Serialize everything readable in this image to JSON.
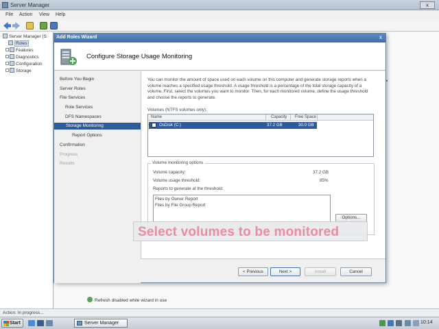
{
  "server_manager": {
    "title": "Server Manager",
    "close_glyph": "x",
    "menu": [
      "File",
      "Action",
      "View",
      "Help"
    ],
    "tree": [
      {
        "label": "Server Manager (S",
        "level": 0
      },
      {
        "label": "Roles",
        "level": 1,
        "selected": true
      },
      {
        "label": "Features",
        "level": 1
      },
      {
        "label": "Diagnostics",
        "level": 1
      },
      {
        "label": "Configuration",
        "level": 1
      },
      {
        "label": "Storage",
        "level": 1
      }
    ],
    "status": "Action: In progress...",
    "refresh_note": "Refresh disabled while wizard in use"
  },
  "wizard": {
    "title": "Add Roles Wizard",
    "close_glyph": "x",
    "heading": "Configure Storage Usage Monitoring",
    "nav": [
      {
        "label": "Before You Begin",
        "level": 1,
        "state": "normal"
      },
      {
        "label": "Server Roles",
        "level": 1,
        "state": "normal"
      },
      {
        "label": "File Services",
        "level": 1,
        "state": "normal"
      },
      {
        "label": "Role Services",
        "level": 2,
        "state": "normal"
      },
      {
        "label": "DFS Namespaces",
        "level": 2,
        "state": "normal"
      },
      {
        "label": "Storage Monitoring",
        "level": 2,
        "state": "active"
      },
      {
        "label": "Report Options",
        "level": 3,
        "state": "normal"
      },
      {
        "label": "Confirmation",
        "level": 1,
        "state": "normal"
      },
      {
        "label": "Progress",
        "level": 1,
        "state": "disabled"
      },
      {
        "label": "Results",
        "level": 1,
        "state": "disabled"
      }
    ],
    "description": "You can monitor the amount of space used on each volume on this computer and generate storage reports when a volume reaches a specified usage threshold. A usage threshold is a percentage of the total storage capacity of a volume. First, select the volumes you want to monitor. Then, for each monitored volume, define the usage threshold and choose the reports to generate.",
    "volumes_label": "Volumes (NTFS volumes only):",
    "volumes_table": {
      "columns": [
        "Name",
        "Capacity",
        "Free Space"
      ],
      "rows": [
        {
          "checked": true,
          "name": "OsDisk (C:)",
          "capacity": "37.2 GB",
          "free_space": "30.0 GB"
        }
      ]
    },
    "monitoring_options": {
      "legend": "Volume monitoring options",
      "capacity_label": "Volume capacity:",
      "capacity_value": "37.2 GB",
      "threshold_label": "Volume usage threshold:",
      "threshold_value": "85%",
      "reports_label": "Reports to generate at the threshold:",
      "reports": [
        "Files by Owner Report",
        "Files by File Group Report"
      ],
      "options_button": "Options..."
    },
    "buttons": {
      "previous": "< Previous",
      "next": "Next >",
      "install": "Install",
      "cancel": "Cancel"
    }
  },
  "caption": "Select volumes to be monitored",
  "taskbar": {
    "start": "Start",
    "task": "Server Manager",
    "clock": "10:14"
  }
}
